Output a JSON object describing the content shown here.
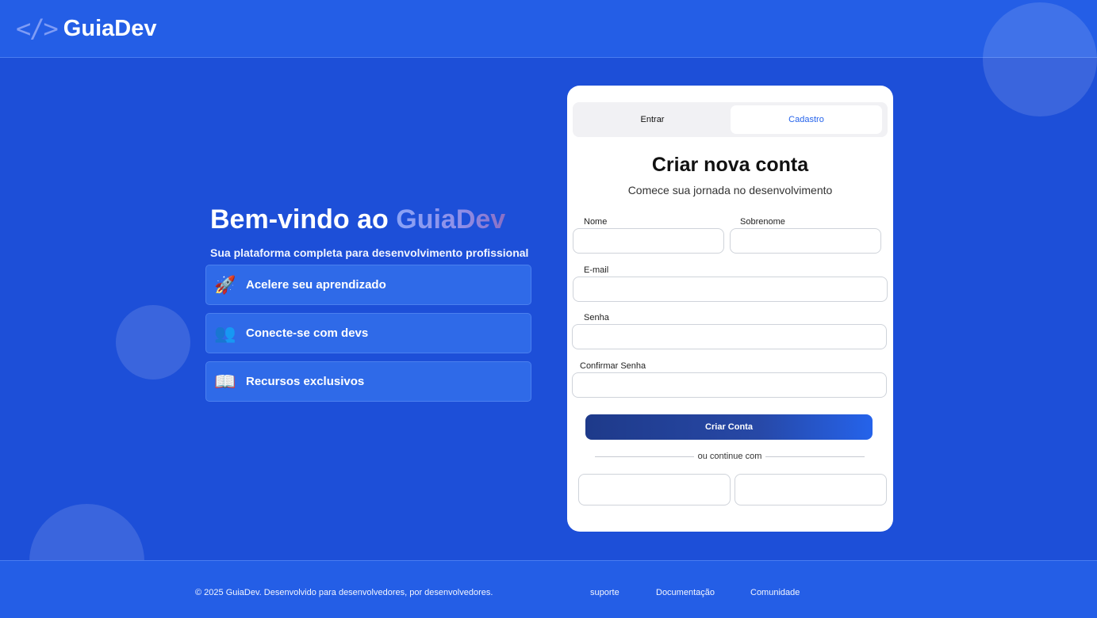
{
  "header": {
    "logo_mark": "</>",
    "logo_text": "GuiaDev"
  },
  "hero": {
    "title_prefix": "Bem-vindo ao ",
    "title_brand": "GuiaDev",
    "subtitle": "Sua plataforma completa para desenvolvimento profissional",
    "features": [
      {
        "icon": "rocket-icon",
        "glyph": "🚀",
        "label": "Acelere seu aprendizado"
      },
      {
        "icon": "people-icon",
        "glyph": "👥",
        "label": "Conecte-se com devs"
      },
      {
        "icon": "book-icon",
        "glyph": "📖",
        "label": "Recursos exclusivos"
      }
    ]
  },
  "auth": {
    "tabs": {
      "login": "Entrar",
      "register": "Cadastro",
      "active": "register"
    },
    "title": "Criar nova conta",
    "subtitle": "Comece sua jornada no desenvolvimento",
    "fields": {
      "first_name": {
        "label": "Nome",
        "value": "",
        "placeholder": ""
      },
      "last_name": {
        "label": "Sobrenome",
        "value": "",
        "placeholder": ""
      },
      "email": {
        "label": "E-mail",
        "value": "",
        "placeholder": ""
      },
      "password": {
        "label": "Senha",
        "value": "",
        "placeholder": ""
      },
      "confirm_password": {
        "label": "Confirmar Senha",
        "value": "",
        "placeholder": ""
      }
    },
    "submit_label": "Criar Conta",
    "divider_text": "ou continue com"
  },
  "footer": {
    "copyright": "© 2025 GuiaDev. Desenvolvido para desenvolvedores, por desenvolvedores.",
    "links": [
      "suporte",
      "Documentação",
      "Comunidade"
    ]
  },
  "colors": {
    "background": "#1d4fd8",
    "header": "#245ee6",
    "accent": "#2563eb",
    "button_start": "#1e3a8a"
  }
}
